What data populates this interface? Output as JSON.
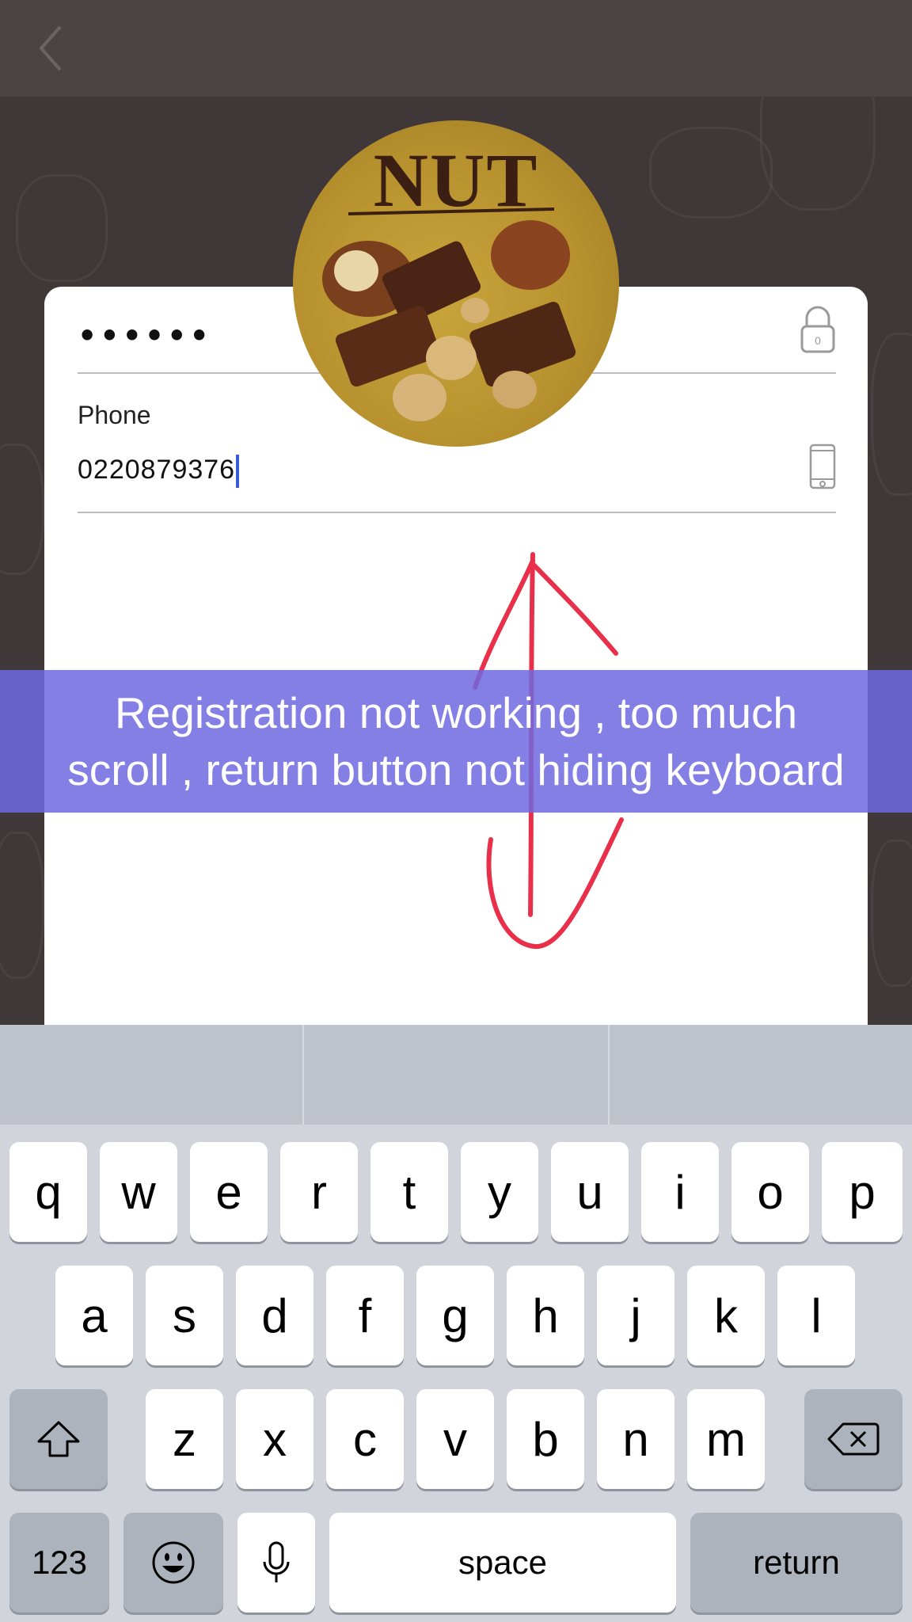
{
  "form": {
    "password_value": "••••••",
    "phone_label": "Phone",
    "phone_value": "0220879376"
  },
  "avatar": {
    "logo_text": "NUT"
  },
  "annotation": {
    "line1": "Registration not working , too much",
    "line2": "scroll , return button not hiding keyboard",
    "arrow_color": "#e8304a",
    "banner_color": "#6e69e1"
  },
  "keyboard": {
    "row1": [
      "q",
      "w",
      "e",
      "r",
      "t",
      "y",
      "u",
      "i",
      "o",
      "p"
    ],
    "row2": [
      "a",
      "s",
      "d",
      "f",
      "g",
      "h",
      "j",
      "k",
      "l"
    ],
    "row3": [
      "z",
      "x",
      "c",
      "v",
      "b",
      "n",
      "m"
    ],
    "numbers_label": "123",
    "space_label": "space",
    "return_label": "return"
  },
  "icons": [
    "back-arrow-icon",
    "lock-icon",
    "phone-icon",
    "shift-icon",
    "backspace-icon",
    "emoji-icon",
    "microphone-icon"
  ]
}
